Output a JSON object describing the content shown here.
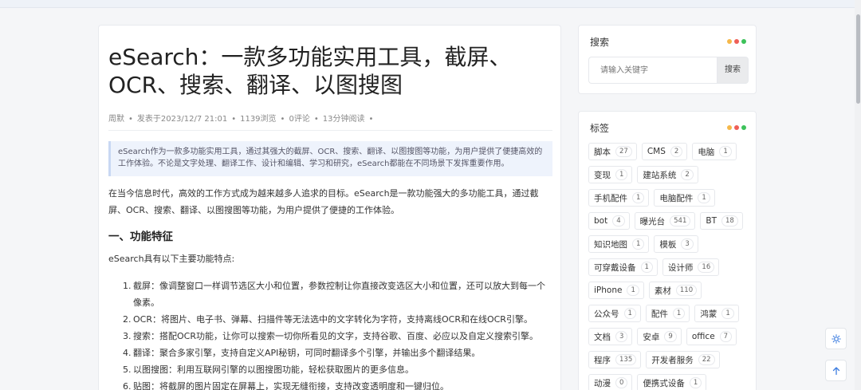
{
  "article": {
    "title": "eSearch：一款多功能实用工具，截屏、OCR、搜索、翻译、以图搜图",
    "meta": {
      "author": "周默",
      "published": "发表于2023/12/7 21:01",
      "views": "1139浏览",
      "comments": "0评论",
      "read_time": "13分钟阅读"
    },
    "summary": "eSearch作为一款多功能实用工具，通过其强大的截屏、OCR、搜索、翻译、以图搜图等功能，为用户提供了便捷高效的工作体验。不论是文字处理、翻译工作、设计和编辑、学习和研究，eSearch都能在不同场景下发挥重要作用。",
    "intro": "在当今信息时代，高效的工作方式成为越来越多人追求的目标。eSearch是一款功能强大的多功能工具，通过截屏、OCR、搜索、翻译、以图搜图等功能，为用户提供了便捷的工作体验。",
    "section_heading": "一、功能特征",
    "section_intro": "eSearch具有以下主要功能特点:",
    "features": [
      {
        "num": "1.",
        "text": "截屏：像调整窗口一样调节选区大小和位置，参数控制让你直接改变选区大小和位置，还可以放大到每一个像素。"
      },
      {
        "num": "2.",
        "text": "OCR：将图片、电子书、弹幕、扫描件等无法选中的文字转化为字符，支持离线OCR和在线OCR引擎。"
      },
      {
        "num": "3.",
        "text": "搜索：搭配OCR功能，让你可以搜索一切你所看见的文字，支持谷歌、百度、必应以及自定义搜索引擎。"
      },
      {
        "num": "4.",
        "text": "翻译：聚合多家引擎，支持自定义API秘钥，可同时翻译多个引擎，并输出多个翻译结果。"
      },
      {
        "num": "5.",
        "text": "以图搜图：利用互联网引擎的以图搜图功能，轻松获取图片的更多信息。"
      },
      {
        "num": "6.",
        "text": "贴图：将截屏的图片固定在屏幕上，实现无缝衔接，支持改变透明度和一键归位。"
      }
    ]
  },
  "search_panel": {
    "title": "搜索",
    "placeholder": "请输入关键字",
    "button": "搜索"
  },
  "tags_panel": {
    "title": "标签",
    "rows": [
      [
        {
          "name": "脚本",
          "count": "27"
        },
        {
          "name": "CMS",
          "count": "2"
        },
        {
          "name": "电脑",
          "count": "1"
        }
      ],
      [
        {
          "name": "变现",
          "count": "1"
        },
        {
          "name": "建站系统",
          "count": "2"
        }
      ],
      [
        {
          "name": "手机配件",
          "count": "1"
        },
        {
          "name": "电脑配件",
          "count": "1"
        }
      ],
      [
        {
          "name": "bot",
          "count": "4"
        },
        {
          "name": "曝光台",
          "count": "541"
        },
        {
          "name": "BT",
          "count": "18"
        }
      ],
      [
        {
          "name": "知识地图",
          "count": "1"
        },
        {
          "name": "模板",
          "count": "3"
        }
      ],
      [
        {
          "name": "可穿戴设备",
          "count": "1"
        },
        {
          "name": "设计师",
          "count": "16"
        }
      ],
      [
        {
          "name": "iPhone",
          "count": "1"
        },
        {
          "name": "素材",
          "count": "110"
        }
      ],
      [
        {
          "name": "公众号",
          "count": "1"
        },
        {
          "name": "配件",
          "count": "1"
        },
        {
          "name": "鸿蒙",
          "count": "1"
        }
      ],
      [
        {
          "name": "文档",
          "count": "3"
        },
        {
          "name": "安卓",
          "count": "9"
        },
        {
          "name": "office",
          "count": "7"
        }
      ],
      [
        {
          "name": "程序",
          "count": "135"
        },
        {
          "name": "开发者服务",
          "count": "22"
        }
      ],
      [
        {
          "name": "动漫",
          "count": "0"
        },
        {
          "name": "便携式设备",
          "count": "1"
        }
      ]
    ]
  },
  "window_dots": [
    "#f5b84a",
    "#ef5f57",
    "#3cc25a"
  ],
  "float_buttons": {
    "theme_icon": "sun-icon",
    "top_icon": "arrow-up-icon"
  }
}
